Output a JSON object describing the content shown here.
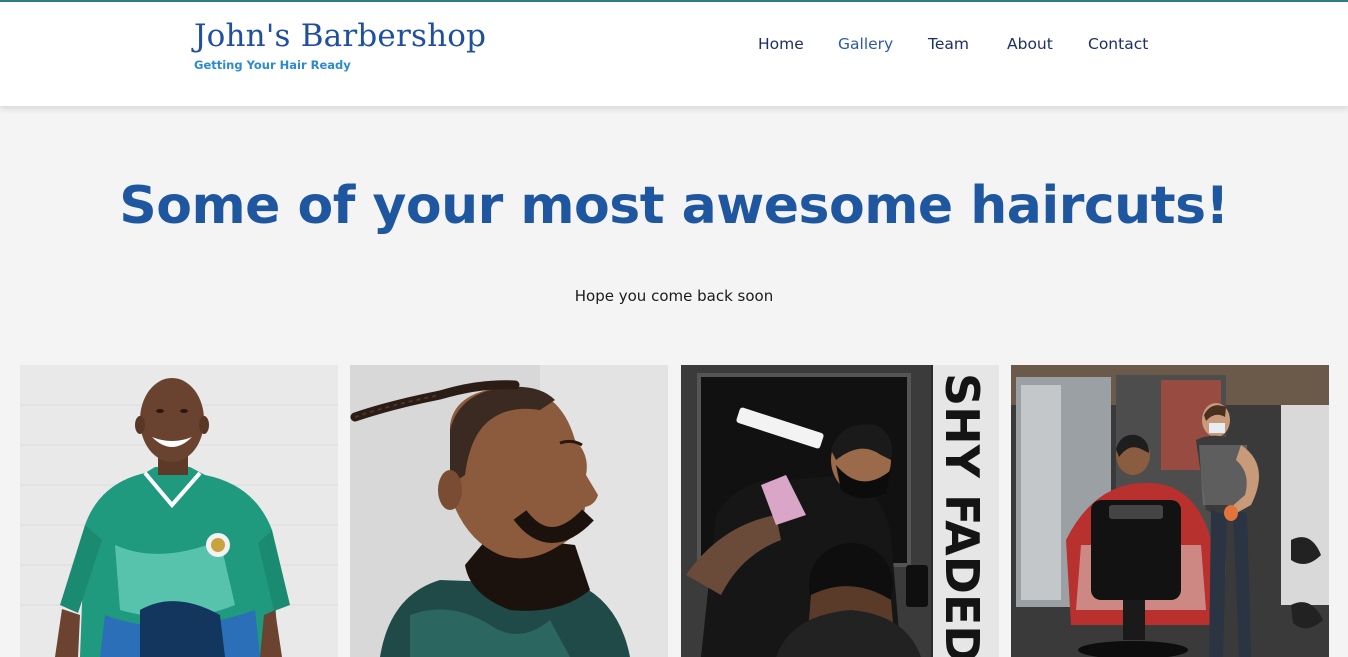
{
  "brand": {
    "title": "John's Barbershop",
    "tagline": "Getting Your Hair Ready"
  },
  "nav": {
    "items": [
      {
        "label": "Home",
        "active": false
      },
      {
        "label": "Gallery",
        "active": true
      },
      {
        "label": "Team",
        "active": false
      },
      {
        "label": "About",
        "active": false
      },
      {
        "label": "Contact",
        "active": false
      }
    ]
  },
  "hero": {
    "title": "Some of your most awesome haircuts!",
    "subtitle": "Hope you come back soon"
  },
  "gallery": {
    "images": [
      {
        "name": "smiling-man-green-jersey-photo"
      },
      {
        "name": "man-braided-top-profile-photo"
      },
      {
        "name": "barber-cutting-hair-shy-faded-photo",
        "sign_text": "SHY FADED"
      },
      {
        "name": "barber-chair-shop-interior-photo"
      }
    ]
  },
  "colors": {
    "brand_blue": "#1f4f9d",
    "tagline_blue": "#2a8bd0",
    "nav_text": "#1d2f66",
    "hero_blue": "#1f56a0",
    "page_bg": "#f4f4f4",
    "accent_line": "#2f7f86"
  }
}
